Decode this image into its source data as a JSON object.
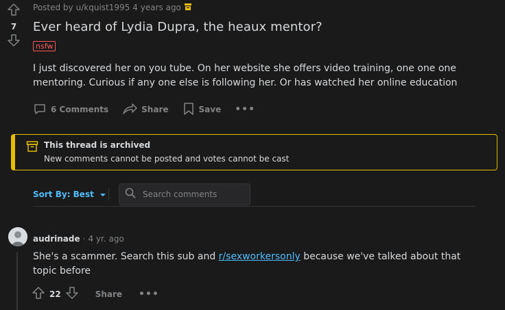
{
  "post": {
    "score": "7",
    "meta_prefix": "Posted by",
    "author": "u/kquist1995",
    "time": "4 years ago",
    "title": "Ever heard of Lydia Dupra, the heaux mentor?",
    "flair": "nsfw",
    "body": "I just discovered her on you tube. On her website she offers video training, one one one mentoring. Curious if any one else is following her. Or has watched her online education",
    "actions": {
      "comments": "6 Comments",
      "share": "Share",
      "save": "Save",
      "more": "•••"
    }
  },
  "archived": {
    "title": "This thread is archived",
    "subtitle": "New comments cannot be posted and votes cannot be cast"
  },
  "sort": {
    "label": "Sort By: Best",
    "search_placeholder": "Search comments"
  },
  "comment": {
    "author": "audrinade",
    "separator": "·",
    "time": "4 yr. ago",
    "body_before": "She's a scammer. Search this sub and ",
    "link": "r/sexworkersonly",
    "body_after": " because we've talked about that topic before",
    "score": "22",
    "share": "Share",
    "more": "•••"
  },
  "colors": {
    "accent_blue": "#4fbcff",
    "archived_yellow": "#e6bd00",
    "nsfw_red": "#ff585b",
    "background": "#1a1a1b"
  }
}
